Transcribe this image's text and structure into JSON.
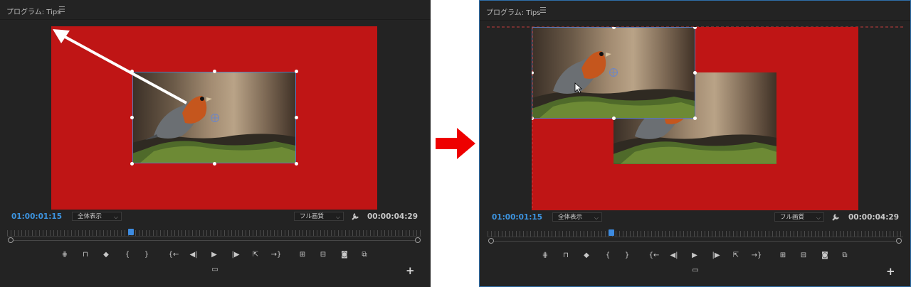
{
  "left_panel": {
    "title": "プログラム: Tips",
    "menu_icon": "☰",
    "current_timecode": "01:00:01:15",
    "zoom_select": "全体表示",
    "quality_select": "フル画質",
    "duration_timecode": "00:00:04:29"
  },
  "right_panel": {
    "title": "プログラム: Tips",
    "menu_icon": "☰",
    "current_timecode": "01:00:01:15",
    "zoom_select": "全体表示",
    "quality_select": "フル画質",
    "duration_timecode": "00:00:04:29"
  },
  "icons": {
    "transport": [
      "add-marker",
      "mark-in",
      "mark-out",
      "clear-in",
      "clear-out",
      "go-to-in",
      "step-back",
      "play",
      "step-forward",
      "go-to-out",
      "insert",
      "overwrite",
      "lift",
      "extract",
      "export-frame",
      "compare"
    ],
    "playhead_position": 0.31
  },
  "colors": {
    "panel_bg": "#232323",
    "red_matte": "#bf1515",
    "timecode_blue": "#3d94e0",
    "selection_border": "#2f6ea8",
    "transition_arrow": "#ee0000"
  }
}
